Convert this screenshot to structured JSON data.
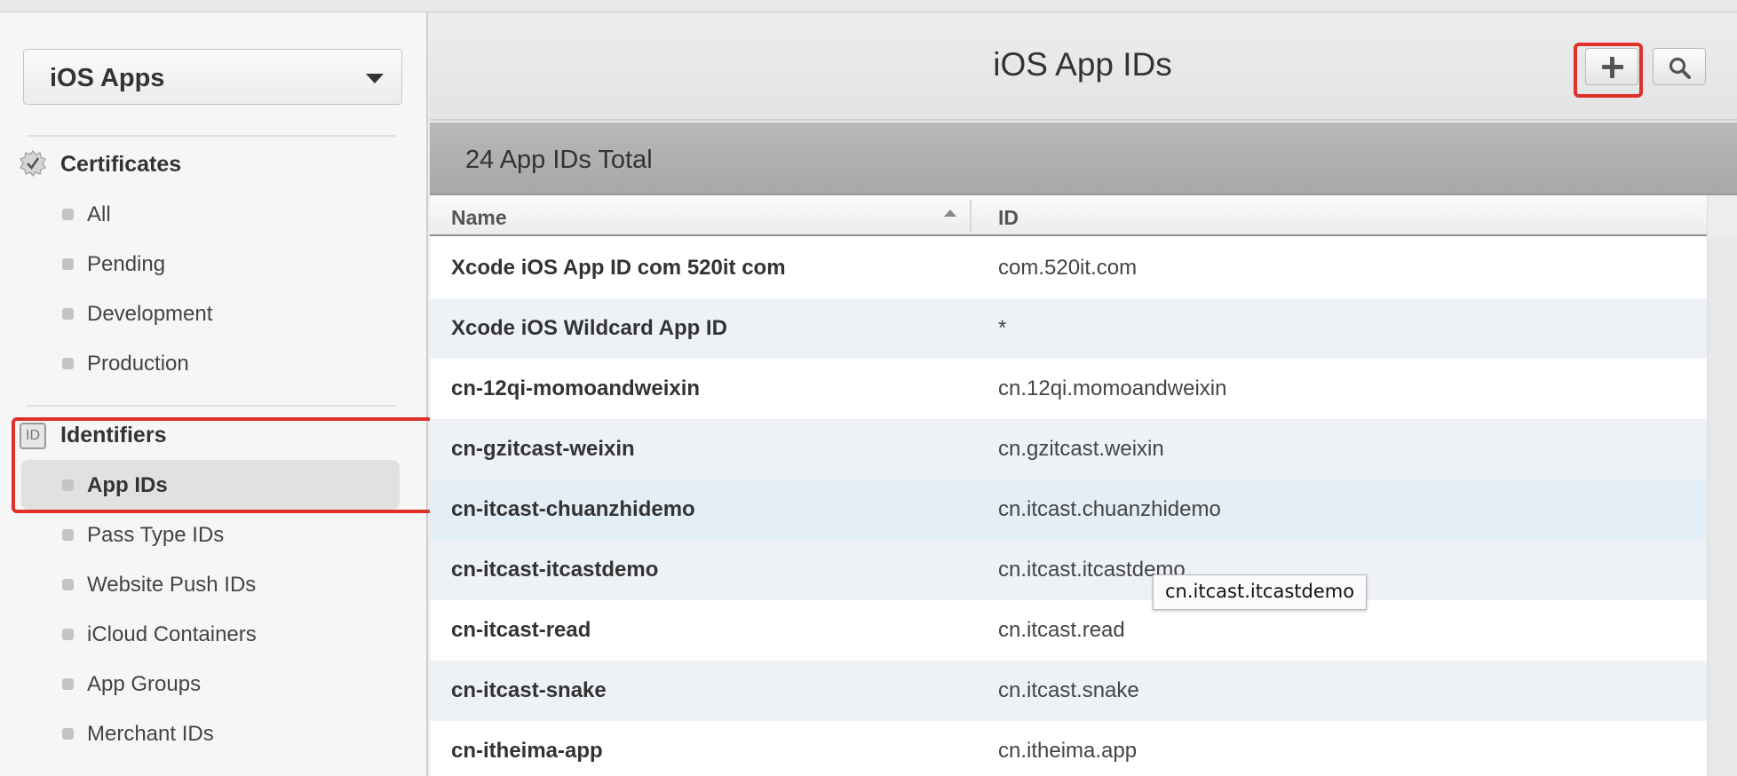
{
  "sidebar": {
    "platform_select": {
      "value": "iOS Apps"
    },
    "certificates": {
      "heading": "Certificates",
      "items": [
        {
          "label": "All"
        },
        {
          "label": "Pending"
        },
        {
          "label": "Development"
        },
        {
          "label": "Production"
        }
      ]
    },
    "identifiers": {
      "icon_text": "ID",
      "heading": "Identifiers",
      "items": [
        {
          "label": "App IDs",
          "active": true
        },
        {
          "label": "Pass Type IDs"
        },
        {
          "label": "Website Push IDs"
        },
        {
          "label": "iCloud Containers"
        },
        {
          "label": "App Groups"
        },
        {
          "label": "Merchant IDs"
        }
      ]
    }
  },
  "header": {
    "title": "iOS App IDs",
    "add_icon": "plus-icon",
    "search_icon": "search-icon"
  },
  "summary": {
    "total_text": "24 App IDs Total"
  },
  "table": {
    "columns": [
      {
        "label": "Name",
        "sort": "ascending"
      },
      {
        "label": "ID"
      }
    ],
    "rows": [
      {
        "name": "Xcode iOS App ID com 520it com",
        "id": "com.520it.com"
      },
      {
        "name": "Xcode iOS Wildcard App ID",
        "id": "*"
      },
      {
        "name": "cn-12qi-momoandweixin",
        "id": "cn.12qi.momoandweixin"
      },
      {
        "name": "cn-gzitcast-weixin",
        "id": "cn.gzitcast.weixin"
      },
      {
        "name": "cn-itcast-chuanzhidemo",
        "id": "cn.itcast.chuanzhidemo"
      },
      {
        "name": "cn-itcast-itcastdemo",
        "id": "cn.itcast.itcastdemo"
      },
      {
        "name": "cn-itcast-read",
        "id": "cn.itcast.read"
      },
      {
        "name": "cn-itcast-snake",
        "id": "cn.itcast.snake"
      },
      {
        "name": "cn-itheima-app",
        "id": "cn.itheima.app"
      }
    ]
  },
  "tooltip": {
    "text": "cn.itcast.itcastdemo"
  },
  "colors": {
    "highlight": "#e0302a",
    "row_alt": "#eef2f7",
    "row_hover": "#e4eef7"
  }
}
